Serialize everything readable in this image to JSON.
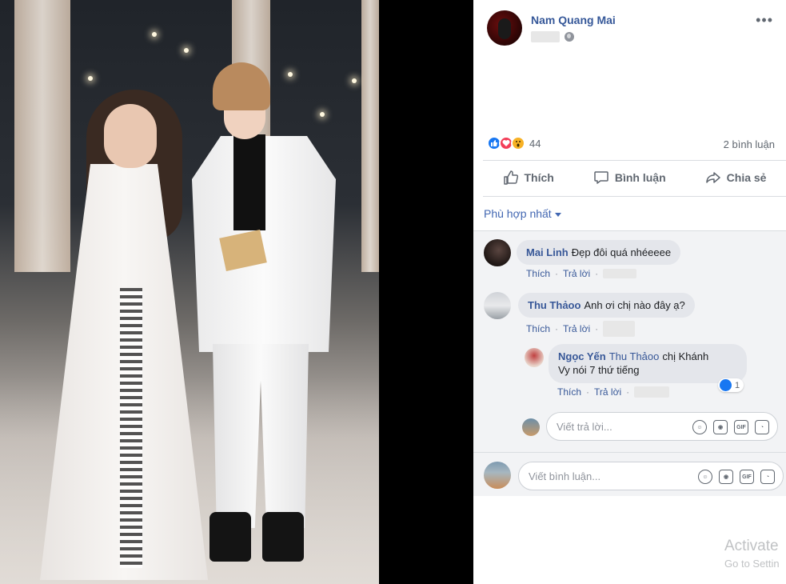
{
  "post": {
    "author": "Nam Quang Mai",
    "more_icon": "more-horizontal-icon",
    "privacy_icon": "globe-icon"
  },
  "stats": {
    "reaction_icons": [
      "like-reaction-icon",
      "love-reaction-icon",
      "wow-reaction-icon"
    ],
    "reaction_count": "44",
    "comment_count": "2 bình luận"
  },
  "actions": {
    "like": "Thích",
    "comment": "Bình luận",
    "share": "Chia sẻ"
  },
  "filter": {
    "label": "Phù hợp nhất"
  },
  "comments": [
    {
      "name": "Mai Linh",
      "text": "Đẹp đôi quá nhéeeee",
      "like": "Thích",
      "reply": "Trả lời"
    },
    {
      "name": "Thu Thảoo",
      "text": "Anh ơi chị nào đây ạ?",
      "like": "Thích",
      "reply": "Trả lời"
    }
  ],
  "reply": {
    "name": "Ngọc Yến",
    "tag": "Thu Thảoo",
    "text_line1": "chị Khánh",
    "text_line2": "Vy nói 7 thứ tiếng",
    "like": "Thích",
    "reply": "Trả lời",
    "like_count": "1"
  },
  "reply_input": {
    "placeholder": "Viết trả lời..."
  },
  "comment_input": {
    "placeholder": "Viết bình luận..."
  },
  "input_icons": [
    "emoji-icon",
    "camera-icon",
    "gif-icon",
    "sticker-icon"
  ],
  "gif_label": "GIF",
  "watermark": {
    "line1": "Activate",
    "line2": "Go to Settin"
  },
  "colors": {
    "link_blue": "#365899",
    "like_blue": "#1877f2",
    "love_red": "#f33e58",
    "wow_yellow": "#f7b125"
  }
}
